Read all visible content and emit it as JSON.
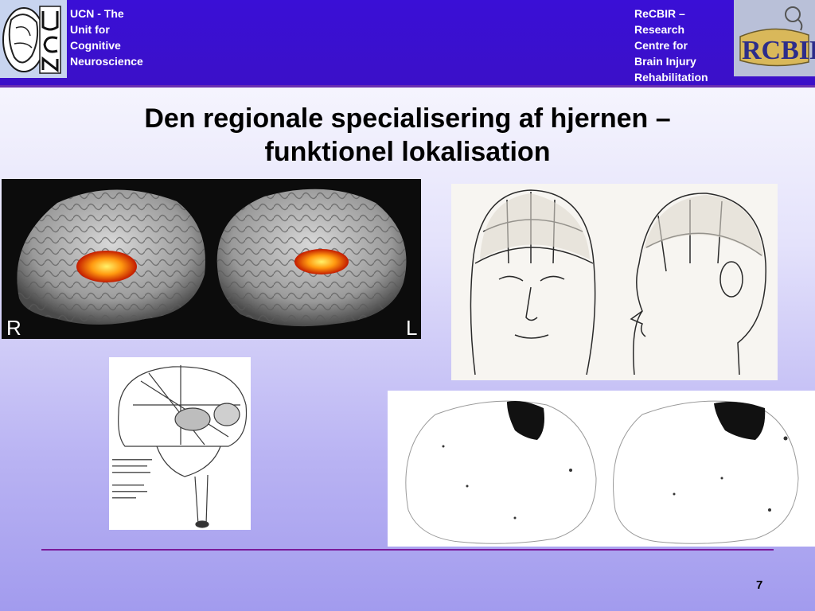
{
  "header": {
    "left_lines": [
      "UCN - The",
      "Unit for",
      "Cognitive",
      "Neuroscience"
    ],
    "right_lines": [
      "ReCBIR –",
      "Research",
      "Centre for",
      "Brain Injury",
      "Rehabilitation"
    ],
    "left_logo_text": "UCN",
    "right_logo_text": "RCBIR"
  },
  "title_line1": "Den regionale specialisering af hjernen –",
  "title_line2": "funktionel lokalisation",
  "brain_labels": {
    "right": "R",
    "left": "L"
  },
  "page_number": "7",
  "colors": {
    "header_bg": "#3a0fd6",
    "accent_rule": "#7a1a9a",
    "activation": "#ff5a00"
  }
}
